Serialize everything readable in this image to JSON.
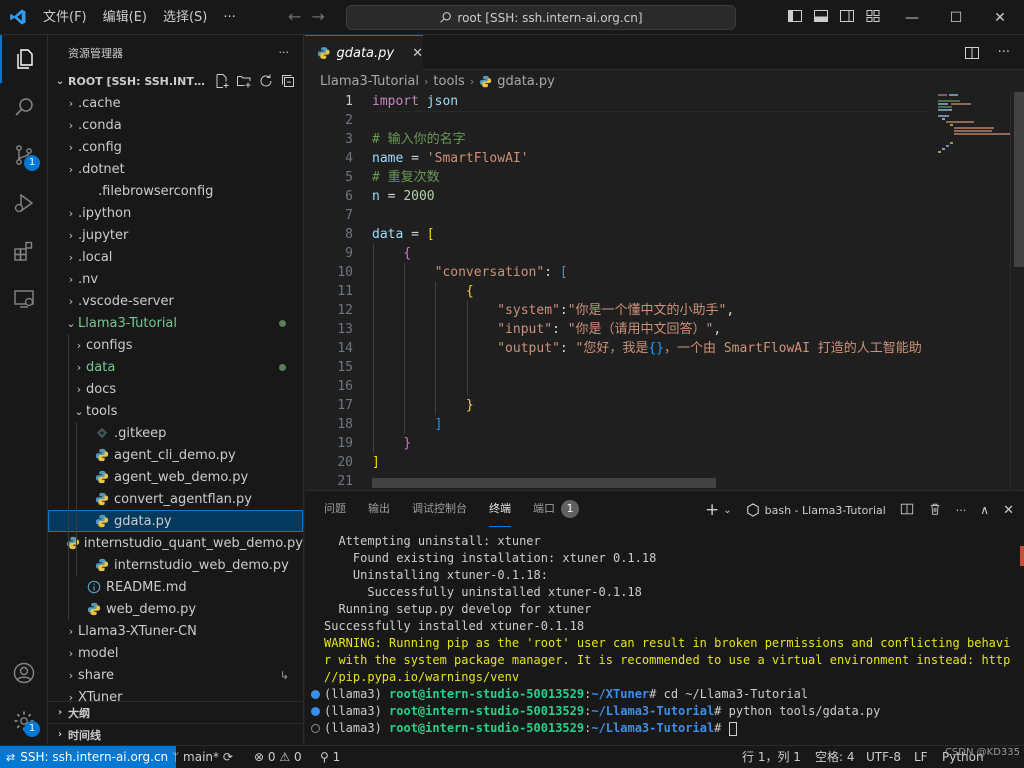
{
  "title_bar": {
    "menu": [
      "文件(F)",
      "编辑(E)",
      "选择(S)",
      "···"
    ],
    "search_text": "root [SSH: ssh.intern-ai.org.cn]"
  },
  "activity_bar": {
    "scm_badge": "1",
    "accounts_badge": "1"
  },
  "sidebar": {
    "title": "资源管理器",
    "more": "···",
    "root_label": "ROOT [SSH: SSH.INTERN-AI.ORG.CN]",
    "items": [
      {
        "label": ".cache",
        "depth": 0,
        "kind": "folder"
      },
      {
        "label": ".conda",
        "depth": 0,
        "kind": "folder"
      },
      {
        "label": ".config",
        "depth": 0,
        "kind": "folder"
      },
      {
        "label": ".dotnet",
        "depth": 0,
        "kind": "folder"
      },
      {
        "label": ".filebrowserconfig",
        "depth": 0,
        "kind": "file-plain"
      },
      {
        "label": ".ipython",
        "depth": 0,
        "kind": "folder"
      },
      {
        "label": ".jupyter",
        "depth": 0,
        "kind": "folder"
      },
      {
        "label": ".local",
        "depth": 0,
        "kind": "folder"
      },
      {
        "label": ".nv",
        "depth": 0,
        "kind": "folder"
      },
      {
        "label": ".vscode-server",
        "depth": 0,
        "kind": "folder"
      },
      {
        "label": "Llama3-Tutorial",
        "depth": 0,
        "kind": "folder-open",
        "modified": true
      },
      {
        "label": "configs",
        "depth": 1,
        "kind": "folder"
      },
      {
        "label": "data",
        "depth": 1,
        "kind": "folder",
        "modified": true
      },
      {
        "label": "docs",
        "depth": 1,
        "kind": "folder"
      },
      {
        "label": "tools",
        "depth": 1,
        "kind": "folder-open"
      },
      {
        "label": ".gitkeep",
        "depth": 2,
        "kind": "file-git"
      },
      {
        "label": "agent_cli_demo.py",
        "depth": 2,
        "kind": "file-py"
      },
      {
        "label": "agent_web_demo.py",
        "depth": 2,
        "kind": "file-py"
      },
      {
        "label": "convert_agentflan.py",
        "depth": 2,
        "kind": "file-py"
      },
      {
        "label": "gdata.py",
        "depth": 2,
        "kind": "file-py",
        "selected": true
      },
      {
        "label": "internstudio_quant_web_demo.py",
        "depth": 2,
        "kind": "file-py"
      },
      {
        "label": "internstudio_web_demo.py",
        "depth": 2,
        "kind": "file-py"
      },
      {
        "label": "README.md",
        "depth": 1,
        "kind": "file-info"
      },
      {
        "label": "web_demo.py",
        "depth": 1,
        "kind": "file-py"
      },
      {
        "label": "Llama3-XTuner-CN",
        "depth": 0,
        "kind": "folder"
      },
      {
        "label": "model",
        "depth": 0,
        "kind": "folder"
      },
      {
        "label": "share",
        "depth": 0,
        "kind": "folder-link"
      },
      {
        "label": "XTuner",
        "depth": 0,
        "kind": "folder"
      }
    ],
    "outline_label": "大纲",
    "timeline_label": "时间线"
  },
  "editor": {
    "tab_label": "gdata.py",
    "tab_close": "✕",
    "breadcrumb": [
      "Llama3-Tutorial",
      "tools",
      "gdata.py"
    ],
    "current_line": 1,
    "lines": [
      [
        [
          "kw",
          "import"
        ],
        [
          "pl",
          " "
        ],
        [
          "id",
          "json"
        ]
      ],
      [],
      [
        [
          "cm",
          "# 输入你的名字"
        ]
      ],
      [
        [
          "id",
          "name"
        ],
        [
          "op",
          " = "
        ],
        [
          "str",
          "'SmartFlowAI'"
        ]
      ],
      [
        [
          "cm",
          "# 重复次数"
        ]
      ],
      [
        [
          "id",
          "n"
        ],
        [
          "op",
          " = "
        ],
        [
          "num",
          "2000"
        ]
      ],
      [],
      [
        [
          "id",
          "data"
        ],
        [
          "op",
          " = "
        ],
        [
          "b1",
          "["
        ]
      ],
      [
        [
          "pl",
          "    "
        ],
        [
          "b2",
          "{"
        ]
      ],
      [
        [
          "pl",
          "        "
        ],
        [
          "str",
          "\"conversation\""
        ],
        [
          "op",
          ": "
        ],
        [
          "b3",
          "["
        ]
      ],
      [
        [
          "pl",
          "            "
        ],
        [
          "b1",
          "{"
        ]
      ],
      [
        [
          "pl",
          "                "
        ],
        [
          "str",
          "\"system\""
        ],
        [
          "op",
          ":"
        ],
        [
          "str",
          "\"你是一个懂中文的小助手\""
        ],
        [
          "op",
          ","
        ]
      ],
      [
        [
          "pl",
          "                "
        ],
        [
          "str",
          "\"input\""
        ],
        [
          "op",
          ": "
        ],
        [
          "str",
          "\"你是（请用中文回答）\""
        ],
        [
          "op",
          ","
        ]
      ],
      [
        [
          "pl",
          "                "
        ],
        [
          "str",
          "\"output\""
        ],
        [
          "op",
          ": "
        ],
        [
          "str",
          "\"您好，我是"
        ],
        [
          "b3",
          "{}"
        ],
        [
          "str",
          "，一个由 SmartFlowAI 打造的人工智能助"
        ]
      ],
      [],
      [],
      [
        [
          "pl",
          "            "
        ],
        [
          "b1",
          "}"
        ]
      ],
      [
        [
          "pl",
          "        "
        ],
        [
          "b3",
          "]"
        ]
      ],
      [
        [
          "pl",
          "    "
        ],
        [
          "b2",
          "}"
        ]
      ],
      [
        [
          "b1",
          "]"
        ]
      ]
    ],
    "line_numbers": [
      "1",
      "2",
      "3",
      "4",
      "5",
      "6",
      "7",
      "8",
      "9",
      "10",
      "11",
      "12",
      "13",
      "14",
      "15",
      "16",
      "17",
      "18",
      "19",
      "20",
      "21"
    ]
  },
  "panel": {
    "tabs": [
      "问题",
      "输出",
      "调试控制台",
      "终端",
      "端口"
    ],
    "active_tab": "终端",
    "ports_badge": "1",
    "terminal_label": "bash - Llama3-Tutorial",
    "more": "···",
    "terminal_lines": [
      {
        "type": "plain",
        "text": "  Attempting uninstall: xtuner"
      },
      {
        "type": "plain",
        "text": "    Found existing installation: xtuner 0.1.18"
      },
      {
        "type": "plain",
        "text": "    Uninstalling xtuner-0.1.18:"
      },
      {
        "type": "plain",
        "text": "      Successfully uninstalled xtuner-0.1.18"
      },
      {
        "type": "plain",
        "text": "  Running setup.py develop for xtuner"
      },
      {
        "type": "plain",
        "text": "Successfully installed xtuner-0.1.18"
      },
      {
        "type": "warn",
        "text": "WARNING: Running pip as the 'root' user can result in broken permissions and conflicting behaviou"
      },
      {
        "type": "warn",
        "text": "r with the system package manager. It is recommended to use a virtual environment instead: https:"
      },
      {
        "type": "warn",
        "text": "//pip.pypa.io/warnings/venv"
      },
      {
        "type": "prompt",
        "status": "ok",
        "env": "(llama3) ",
        "user": "root@intern-studio-50013529",
        "path": "~/XTuner",
        "cmd": "# cd ~/Llama3-Tutorial"
      },
      {
        "type": "prompt",
        "status": "ok",
        "env": "(llama3) ",
        "user": "root@intern-studio-50013529",
        "path": "~/Llama3-Tutorial",
        "cmd": "# python tools/gdata.py"
      },
      {
        "type": "prompt",
        "status": "idle",
        "env": "(llama3) ",
        "user": "root@intern-studio-50013529",
        "path": "~/Llama3-Tutorial",
        "cmd": "# "
      }
    ]
  },
  "status_bar": {
    "remote": "SSH: ssh.intern-ai.org.cn",
    "branch": "main*",
    "errors": "0",
    "warnings": "0",
    "ports": "1",
    "position": "行 1，列 1",
    "spaces": "空格: 4",
    "encoding": "UTF-8",
    "eol": "LF",
    "language": "Python",
    "watermark": "CSDN @KD335"
  },
  "colors": {
    "accent": "#0078d4",
    "modified": "#73c991",
    "warning_text": "#e5e510"
  }
}
